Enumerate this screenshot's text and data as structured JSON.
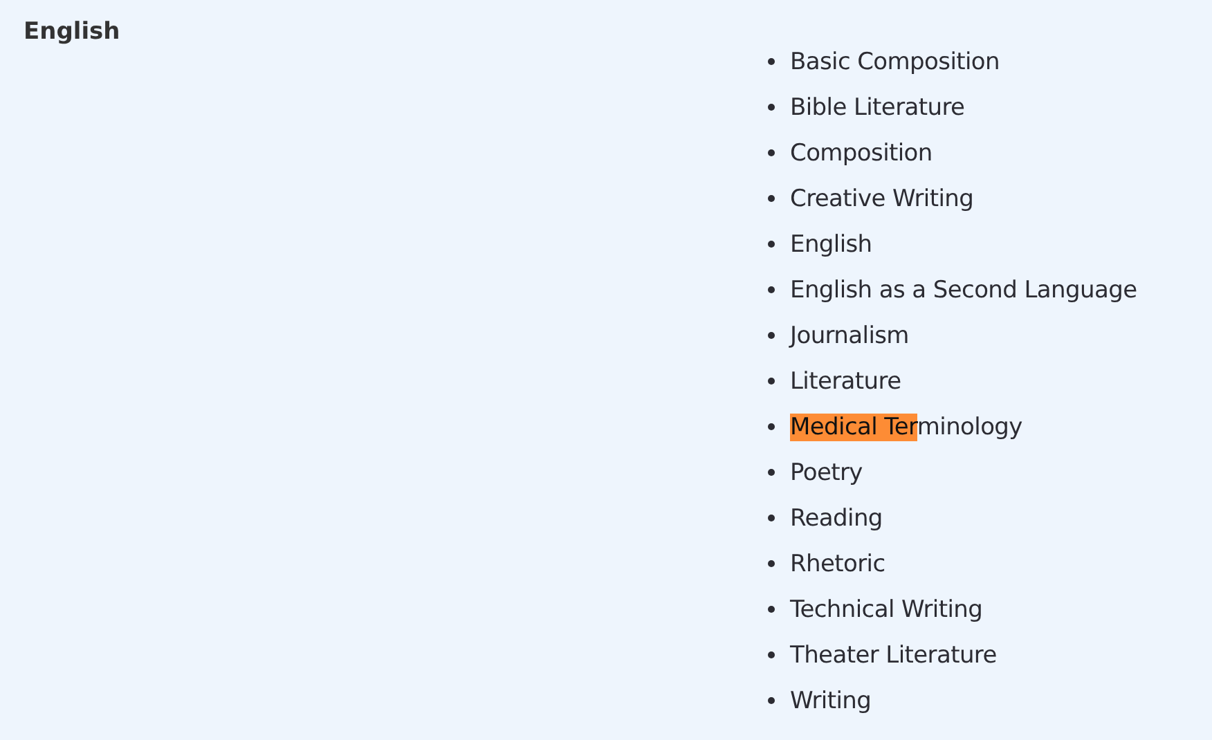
{
  "heading": "English",
  "items": [
    {
      "parts": [
        {
          "text": "Basic Composition",
          "highlighted": false
        }
      ]
    },
    {
      "parts": [
        {
          "text": "Bible Literature",
          "highlighted": false
        }
      ]
    },
    {
      "parts": [
        {
          "text": "Composition",
          "highlighted": false
        }
      ]
    },
    {
      "parts": [
        {
          "text": "Creative Writing",
          "highlighted": false
        }
      ]
    },
    {
      "parts": [
        {
          "text": "English",
          "highlighted": false
        }
      ]
    },
    {
      "parts": [
        {
          "text": "English as a Second Language",
          "highlighted": false
        }
      ]
    },
    {
      "parts": [
        {
          "text": "Journalism",
          "highlighted": false
        }
      ]
    },
    {
      "parts": [
        {
          "text": "Literature",
          "highlighted": false
        }
      ]
    },
    {
      "parts": [
        {
          "text": "Medical Ter",
          "highlighted": true
        },
        {
          "text": "minology",
          "highlighted": false
        }
      ]
    },
    {
      "parts": [
        {
          "text": "Poetry",
          "highlighted": false
        }
      ]
    },
    {
      "parts": [
        {
          "text": "Reading",
          "highlighted": false
        }
      ]
    },
    {
      "parts": [
        {
          "text": "Rhetoric",
          "highlighted": false
        }
      ]
    },
    {
      "parts": [
        {
          "text": "Technical Writing",
          "highlighted": false
        }
      ]
    },
    {
      "parts": [
        {
          "text": "Theater Literature",
          "highlighted": false
        }
      ]
    },
    {
      "parts": [
        {
          "text": "Writing",
          "highlighted": false
        }
      ]
    }
  ]
}
